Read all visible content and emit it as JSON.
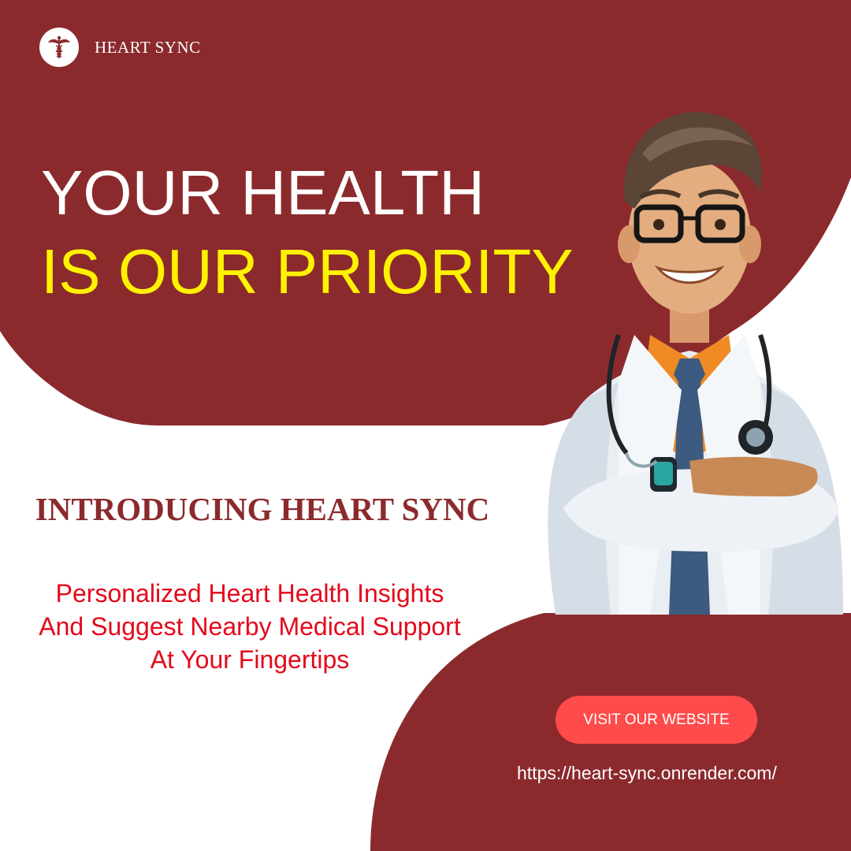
{
  "brand": {
    "name": "HEART SYNC",
    "logo_icon": "caduceus-icon"
  },
  "headline": {
    "line1": "YOUR HEALTH",
    "line2": "IS OUR PRIORITY"
  },
  "intro": "INTRODUCING HEART SYNC",
  "description": {
    "lines": [
      "Personalized Heart Health Insights",
      "And Suggest Nearby Medical Support",
      "At Your Fingertips"
    ]
  },
  "cta": {
    "label": "VISIT OUR WEBSITE"
  },
  "url": "https://heart-sync.onrender.com/",
  "illustration": {
    "subject": "doctor-illustration"
  },
  "colors": {
    "brand_maroon": "#8b2a2d",
    "headline_yellow": "#fff200",
    "description_red": "#e3091b",
    "button_red": "#ff4b4b",
    "white": "#ffffff"
  }
}
